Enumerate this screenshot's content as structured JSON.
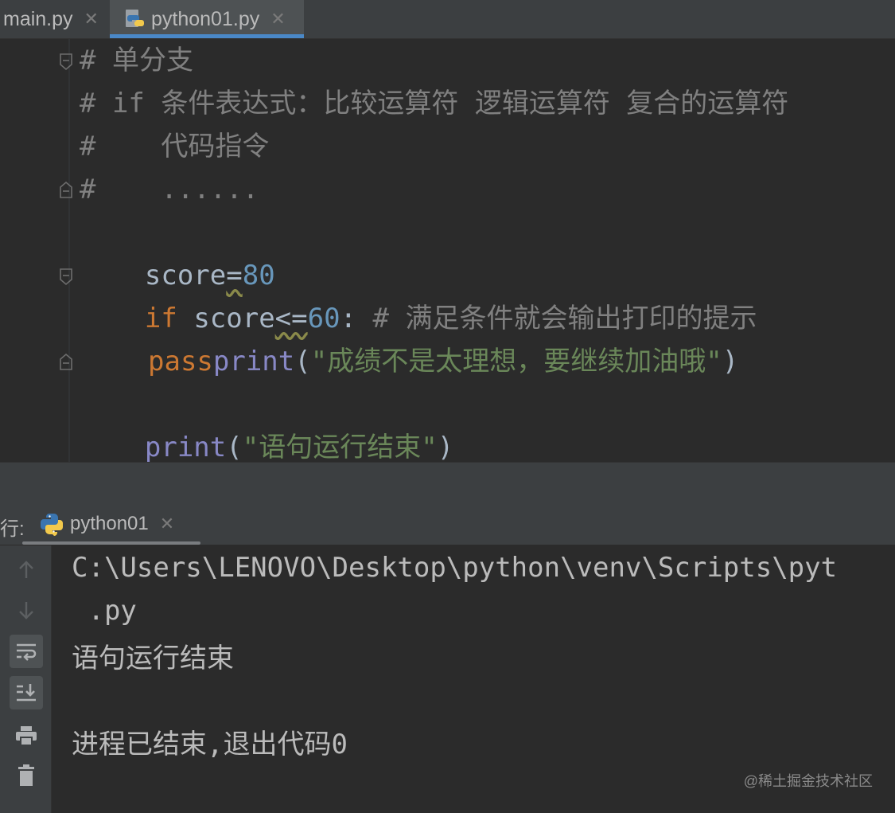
{
  "editor_tabs": [
    {
      "label": "main.py",
      "close": "✕",
      "active": false
    },
    {
      "label": "python01.py",
      "close": "✕",
      "active": true,
      "icon": "python-file-icon"
    }
  ],
  "code": {
    "l1": "# 单分支",
    "l2": "# if 条件表达式：比较运算符 逻辑运算符 复合的运算符",
    "l3": "#    代码指令",
    "l4": "#    ......",
    "l5_var": "score",
    "l5_op": "=",
    "l5_num": "80",
    "l6_kw": "if",
    "l6_var": " score",
    "l6_op": "<=",
    "l6_num": "60",
    "l6_colon": ":",
    "l6_comment": " # 满足条件就会输出打印的提示",
    "l7_fn": "print",
    "l7_open": "(",
    "l7_str": "\"成绩不是太理想，要继续加油哦\"",
    "l7_close": ")",
    "l8_kw": "pass",
    "l9_fn": "print",
    "l9_open": "(",
    "l9_str": "\"语句运行结束\"",
    "l9_close": ")"
  },
  "run_panel": {
    "label": "行:",
    "tab_label": "python01",
    "tab_close": "✕",
    "tools": [
      "up-arrow-icon",
      "down-arrow-icon",
      "soft-wrap-icon",
      "scroll-to-end-icon",
      "print-icon",
      "trash-icon"
    ]
  },
  "console": {
    "line1": "C:\\Users\\LENOVO\\Desktop\\python\\venv\\Scripts\\pyt",
    "line2": " .py",
    "line3": "语句运行结束",
    "line4": "进程已结束,退出代码0"
  },
  "watermark": "@稀土掘金技术社区",
  "colors": {
    "keyword": "#cc7832",
    "number": "#6897bb",
    "string": "#6a8759",
    "builtin": "#8888c6",
    "comment": "#808080",
    "background": "#2b2b2b",
    "active_tab_underline": "#4a88c7"
  }
}
